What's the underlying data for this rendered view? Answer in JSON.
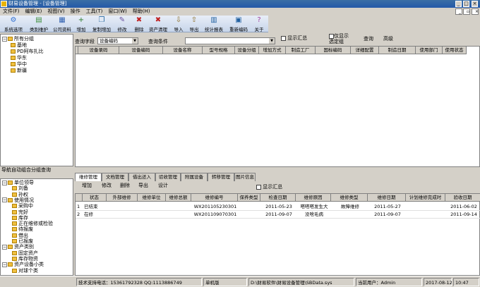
{
  "window": {
    "title": "财易设备管理 - [设备管理]"
  },
  "menu": [
    "文件(F)",
    "编辑(E)",
    "视图(V)",
    "操作",
    "工具(T)",
    "窗口(W)",
    "帮助(H)"
  ],
  "toolbar": [
    {
      "label": "系统选项",
      "icon": "⚙"
    },
    {
      "label": "类别维护",
      "icon": "▤"
    },
    {
      "label": "公司资料",
      "icon": "▦"
    },
    {
      "label": "增加",
      "icon": "+"
    },
    {
      "label": "复制增加",
      "icon": "❐"
    },
    {
      "label": "修改",
      "icon": "✎"
    },
    {
      "label": "删除",
      "icon": "✖"
    },
    {
      "label": "资产清理",
      "icon": "✖"
    },
    {
      "label": "导入",
      "icon": "⇩"
    },
    {
      "label": "导出",
      "icon": "⇧"
    },
    {
      "label": "统计报表",
      "icon": "▥"
    },
    {
      "label": "重新编码",
      "icon": "▣"
    },
    {
      "label": "关于",
      "icon": "?"
    }
  ],
  "options": {
    "show_summary": "显示汇总",
    "show_selected_only": "仅显示\n选定组",
    "query": "查询",
    "advanced": "高级"
  },
  "query": {
    "field_label": "查询字段",
    "field_value": "设备编码",
    "cond_label": "查询条件"
  },
  "tree_top": {
    "root": "所有分组",
    "items": [
      "基地",
      "PD阿布扎比",
      "华东",
      "华中",
      "新疆"
    ]
  },
  "nav_head": "导航自动组合分组查询",
  "tree_bottom": {
    "groups": [
      {
        "label": "单位领导",
        "items": [
          "刘备",
          "孙权"
        ]
      },
      {
        "label": "使用情况",
        "items": [
          "采购中",
          "完好",
          "库存",
          "正在维修或检验",
          "待报废",
          "借出",
          "已报废"
        ]
      },
      {
        "label": "资产类别",
        "items": [
          "固定资产",
          "库存物资"
        ]
      },
      {
        "label": "资产设备小类",
        "items": [
          "对球个类"
        ]
      }
    ]
  },
  "grid1_columns": [
    "设备录码",
    "设备编码",
    "设备名称",
    "型号规格",
    "设备分组",
    "增加方式",
    "制造工厂",
    "国标编码",
    "详细配置",
    "制造日期",
    "使用部门",
    "使用状态"
  ],
  "tabs": [
    "维修管理",
    "文档管理",
    "借出还入",
    "验收管理",
    "附属设备",
    "转移管理",
    "图片信息"
  ],
  "sub_toolbar": [
    "增加",
    "修改",
    "删除",
    "导出",
    "设计"
  ],
  "sub_show_summary": "显示汇总",
  "grid2_columns": [
    "状态",
    "外部维修",
    "维修单位",
    "维修总额",
    "维修编号",
    "保养类型",
    "检查日期",
    "维修原因",
    "维修类型",
    "维修日期",
    "计划维修完成时",
    "验收日期"
  ],
  "grid2_rows": [
    {
      "no": "1",
      "status": "已结束",
      "code": "WX201105230301",
      "check_date": "2011-05-23",
      "reason": "嗒嗒嗒发生大",
      "type": "故障维修",
      "repair_date": "2011-05-27",
      "accept_date": "2011-06-02"
    },
    {
      "no": "2",
      "status": "在修",
      "code": "WX201109070301",
      "check_date": "2011-09-07",
      "reason": "没啥毛病",
      "type": "",
      "repair_date": "2011-09-07",
      "accept_date": "2011-09-14"
    }
  ],
  "status": {
    "support": "技术支持电话：15361792328  QQ:1113886749",
    "edition": "单机版",
    "path": "D:\\财易软件\\财易设备管理\\SBData.sys",
    "user": "当前用户：Admin",
    "date": "2017-08-12",
    "time": "10:47"
  }
}
